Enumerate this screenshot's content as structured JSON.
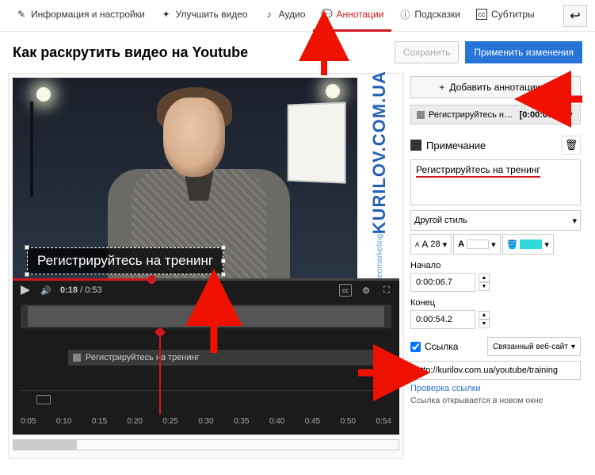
{
  "tabs": {
    "info": "Информация и настройки",
    "enhance": "Улучшить видео",
    "audio": "Аудио",
    "annotations": "Аннотации",
    "cards": "Подсказки",
    "subtitles": "Субтитры"
  },
  "title": "Как раскрутить видео на Youtube",
  "actions": {
    "save": "Сохранить",
    "apply": "Применить изменения"
  },
  "video": {
    "brand": "KURILOV.COM.UA",
    "brand_sub": "videomarketing",
    "annotation_text": "Регистрируйтесь на тренинг",
    "time_current": "0:18",
    "time_total": "0:53"
  },
  "timeline": {
    "item_label": "Регистрируйтесь на тренинг",
    "ticks": [
      "0:05",
      "0:10",
      "0:15",
      "0:20",
      "0:25",
      "0:30",
      "0:35",
      "0:40",
      "0:45",
      "0:50",
      "0:54"
    ]
  },
  "panel": {
    "add": "Добавить аннотацию",
    "item_name": "Регистрируйтесь на трен...",
    "item_time": "[0:00:06.7]",
    "note_header": "Примечание",
    "note_value": "Регистрируйтесь на тренинг",
    "style_select": "Другой стиль",
    "font_size": "28",
    "start_label": "Начало",
    "start_value": "0:00:06.7",
    "end_label": "Конец",
    "end_value": "0:00:54.2",
    "link_label": "Ссылка",
    "link_type": "Связанный веб-сайт",
    "url": "http://kurilov.com.ua/youtube/training",
    "link_check": "Проверка ссылки",
    "link_note": "Ссылка открывается в новом окне"
  }
}
